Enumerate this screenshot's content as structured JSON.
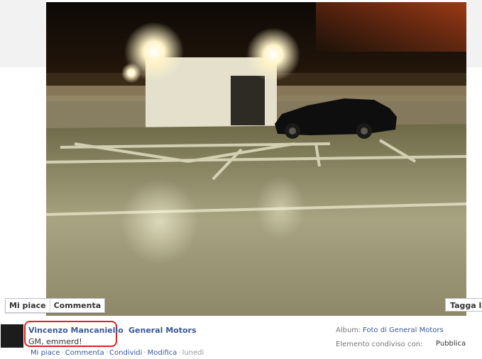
{
  "photo": {
    "alt": "Parcheggio notturno"
  },
  "actions": {
    "like": "Mi piace",
    "comment": "Commenta"
  },
  "tag": {
    "label": "Tagga la"
  },
  "post": {
    "author": "Vincenzo Mancaniello",
    "page": "General Motors",
    "caption": "GM, emmerd!"
  },
  "meta_links": [
    {
      "label": "Mi piace"
    },
    {
      "label": "Commenta"
    },
    {
      "label": "Condividi"
    },
    {
      "label": "Modifica"
    }
  ],
  "meta_sep": "·",
  "timestamp": "lunedì",
  "album": {
    "label": "Album:",
    "link": "Foto di General Motors"
  },
  "shared": {
    "label": "Elemento condiviso con:",
    "privacy": "Pubblica"
  },
  "colors": {
    "link": "#3b5998",
    "highlight": "#e02020"
  }
}
